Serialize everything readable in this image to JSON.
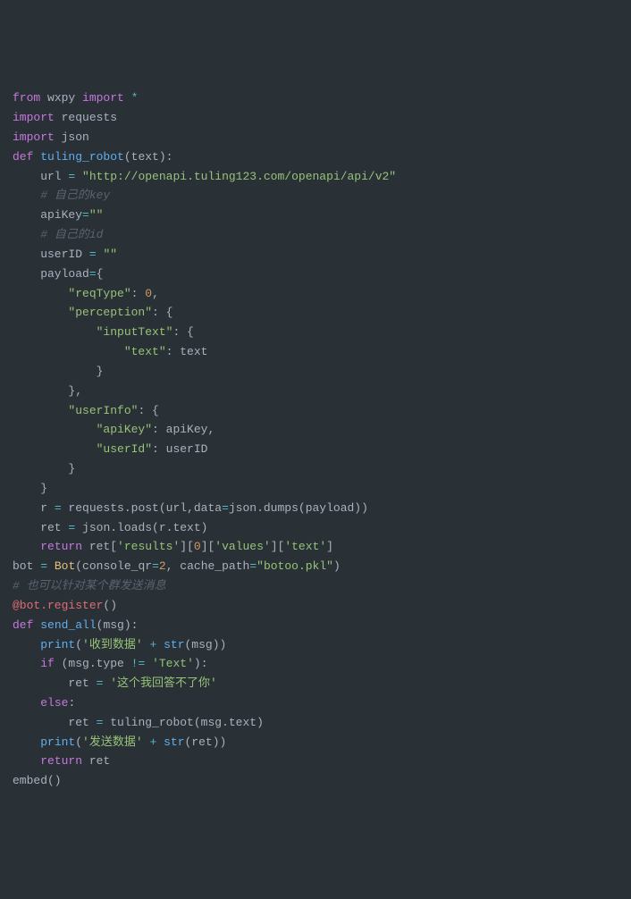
{
  "code": {
    "lines": [
      [
        {
          "cls": "kw",
          "t": "from"
        },
        {
          "cls": "pl",
          "t": " wxpy "
        },
        {
          "cls": "kw",
          "t": "import"
        },
        {
          "cls": "pl",
          "t": " "
        },
        {
          "cls": "op",
          "t": "*"
        }
      ],
      [
        {
          "cls": "kw",
          "t": "import"
        },
        {
          "cls": "pl",
          "t": " requests"
        }
      ],
      [
        {
          "cls": "kw",
          "t": "import"
        },
        {
          "cls": "pl",
          "t": " json"
        }
      ],
      [
        {
          "cls": "kw",
          "t": "def"
        },
        {
          "cls": "pl",
          "t": " "
        },
        {
          "cls": "fnc",
          "t": "tuling_robot"
        },
        {
          "cls": "pl",
          "t": "(text):"
        }
      ],
      [
        {
          "cls": "pl",
          "t": "    url "
        },
        {
          "cls": "op",
          "t": "="
        },
        {
          "cls": "pl",
          "t": " "
        },
        {
          "cls": "st",
          "t": "\"http://openapi.tuling123.com/openapi/api/v2\""
        }
      ],
      [
        {
          "cls": "pl",
          "t": "    "
        },
        {
          "cls": "cm",
          "t": "# 自己的key"
        }
      ],
      [
        {
          "cls": "pl",
          "t": "    apiKey"
        },
        {
          "cls": "op",
          "t": "="
        },
        {
          "cls": "st",
          "t": "\"\""
        }
      ],
      [
        {
          "cls": "pl",
          "t": "    "
        },
        {
          "cls": "cm",
          "t": "# 自己的id"
        }
      ],
      [
        {
          "cls": "pl",
          "t": "    userID "
        },
        {
          "cls": "op",
          "t": "="
        },
        {
          "cls": "pl",
          "t": " "
        },
        {
          "cls": "st",
          "t": "\"\""
        }
      ],
      [
        {
          "cls": "pl",
          "t": "    payload"
        },
        {
          "cls": "op",
          "t": "="
        },
        {
          "cls": "pl",
          "t": "{"
        }
      ],
      [
        {
          "cls": "pl",
          "t": "        "
        },
        {
          "cls": "st",
          "t": "\"reqType\""
        },
        {
          "cls": "pl",
          "t": ": "
        },
        {
          "cls": "nm",
          "t": "0"
        },
        {
          "cls": "pl",
          "t": ","
        }
      ],
      [
        {
          "cls": "pl",
          "t": "        "
        },
        {
          "cls": "st",
          "t": "\"perception\""
        },
        {
          "cls": "pl",
          "t": ": {"
        }
      ],
      [
        {
          "cls": "pl",
          "t": "            "
        },
        {
          "cls": "st",
          "t": "\"inputText\""
        },
        {
          "cls": "pl",
          "t": ": {"
        }
      ],
      [
        {
          "cls": "pl",
          "t": "                "
        },
        {
          "cls": "st",
          "t": "\"text\""
        },
        {
          "cls": "pl",
          "t": ": text"
        }
      ],
      [
        {
          "cls": "pl",
          "t": "            }"
        }
      ],
      [
        {
          "cls": "pl",
          "t": "        },"
        }
      ],
      [
        {
          "cls": "pl",
          "t": "        "
        },
        {
          "cls": "st",
          "t": "\"userInfo\""
        },
        {
          "cls": "pl",
          "t": ": {"
        }
      ],
      [
        {
          "cls": "pl",
          "t": "            "
        },
        {
          "cls": "st",
          "t": "\"apiKey\""
        },
        {
          "cls": "pl",
          "t": ": apiKey,"
        }
      ],
      [
        {
          "cls": "pl",
          "t": "            "
        },
        {
          "cls": "st",
          "t": "\"userId\""
        },
        {
          "cls": "pl",
          "t": ": userID"
        }
      ],
      [
        {
          "cls": "pl",
          "t": "        }"
        }
      ],
      [
        {
          "cls": "pl",
          "t": "    }"
        }
      ],
      [
        {
          "cls": "pl",
          "t": "    r "
        },
        {
          "cls": "op",
          "t": "="
        },
        {
          "cls": "pl",
          "t": " requests.post(url,data"
        },
        {
          "cls": "op",
          "t": "="
        },
        {
          "cls": "pl",
          "t": "json.dumps(payload))"
        }
      ],
      [
        {
          "cls": "pl",
          "t": "    ret "
        },
        {
          "cls": "op",
          "t": "="
        },
        {
          "cls": "pl",
          "t": " json.loads(r.text)"
        }
      ],
      [
        {
          "cls": "pl",
          "t": "    "
        },
        {
          "cls": "kw",
          "t": "return"
        },
        {
          "cls": "pl",
          "t": " ret["
        },
        {
          "cls": "st",
          "t": "'results'"
        },
        {
          "cls": "pl",
          "t": "]["
        },
        {
          "cls": "nm",
          "t": "0"
        },
        {
          "cls": "pl",
          "t": "]["
        },
        {
          "cls": "st",
          "t": "'values'"
        },
        {
          "cls": "pl",
          "t": "]["
        },
        {
          "cls": "st",
          "t": "'text'"
        },
        {
          "cls": "pl",
          "t": "]"
        }
      ],
      [
        {
          "cls": "pl",
          "t": "bot "
        },
        {
          "cls": "op",
          "t": "="
        },
        {
          "cls": "pl",
          "t": " "
        },
        {
          "cls": "fn",
          "t": "Bot"
        },
        {
          "cls": "pl",
          "t": "(console_qr"
        },
        {
          "cls": "op",
          "t": "="
        },
        {
          "cls": "nm",
          "t": "2"
        },
        {
          "cls": "pl",
          "t": ", cache_path"
        },
        {
          "cls": "op",
          "t": "="
        },
        {
          "cls": "st",
          "t": "\"botoo.pkl\""
        },
        {
          "cls": "pl",
          "t": ")"
        }
      ],
      [
        {
          "cls": "cm",
          "t": "# 也可以针对某个群发送消息"
        }
      ],
      [
        {
          "cls": "dc",
          "t": "@bot.register"
        },
        {
          "cls": "pl",
          "t": "()"
        }
      ],
      [
        {
          "cls": "kw",
          "t": "def"
        },
        {
          "cls": "pl",
          "t": " "
        },
        {
          "cls": "fnc",
          "t": "send_all"
        },
        {
          "cls": "pl",
          "t": "(msg):"
        }
      ],
      [
        {
          "cls": "pl",
          "t": "    "
        },
        {
          "cls": "fnc",
          "t": "print"
        },
        {
          "cls": "pl",
          "t": "("
        },
        {
          "cls": "st",
          "t": "'收到数据'"
        },
        {
          "cls": "pl",
          "t": " "
        },
        {
          "cls": "op",
          "t": "+"
        },
        {
          "cls": "pl",
          "t": " "
        },
        {
          "cls": "fnc",
          "t": "str"
        },
        {
          "cls": "pl",
          "t": "(msg))"
        }
      ],
      [
        {
          "cls": "pl",
          "t": "    "
        },
        {
          "cls": "kw",
          "t": "if"
        },
        {
          "cls": "pl",
          "t": " (msg.type "
        },
        {
          "cls": "op",
          "t": "!="
        },
        {
          "cls": "pl",
          "t": " "
        },
        {
          "cls": "st",
          "t": "'Text'"
        },
        {
          "cls": "pl",
          "t": "):"
        }
      ],
      [
        {
          "cls": "pl",
          "t": "        ret "
        },
        {
          "cls": "op",
          "t": "="
        },
        {
          "cls": "pl",
          "t": " "
        },
        {
          "cls": "st",
          "t": "'这个我回答不了你'"
        }
      ],
      [
        {
          "cls": "pl",
          "t": "    "
        },
        {
          "cls": "kw",
          "t": "else"
        },
        {
          "cls": "pl",
          "t": ":"
        }
      ],
      [
        {
          "cls": "pl",
          "t": "        ret "
        },
        {
          "cls": "op",
          "t": "="
        },
        {
          "cls": "pl",
          "t": " tuling_robot(msg.text)"
        }
      ],
      [
        {
          "cls": "pl",
          "t": "    "
        },
        {
          "cls": "fnc",
          "t": "print"
        },
        {
          "cls": "pl",
          "t": "("
        },
        {
          "cls": "st",
          "t": "'发送数据'"
        },
        {
          "cls": "pl",
          "t": " "
        },
        {
          "cls": "op",
          "t": "+"
        },
        {
          "cls": "pl",
          "t": " "
        },
        {
          "cls": "fnc",
          "t": "str"
        },
        {
          "cls": "pl",
          "t": "(ret))"
        }
      ],
      [
        {
          "cls": "pl",
          "t": "    "
        },
        {
          "cls": "kw",
          "t": "return"
        },
        {
          "cls": "pl",
          "t": " ret"
        }
      ],
      [
        {
          "cls": "pl",
          "t": "embed()"
        }
      ]
    ]
  }
}
